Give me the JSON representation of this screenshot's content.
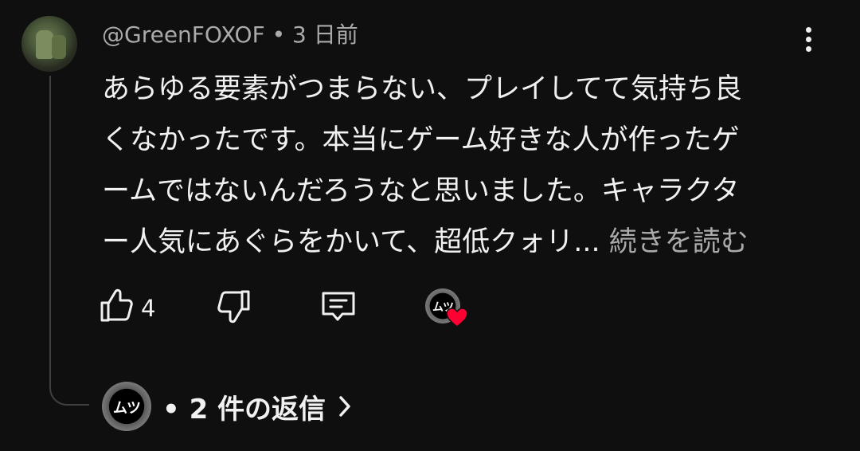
{
  "comment": {
    "author": "@GreenFOXOF",
    "separator": "•",
    "time": "3 日前",
    "lines": [
      "あらゆる要素がつまらない、プレイしてて気持ち良",
      "くなかったです。本当にゲーム好きな人が作ったゲ",
      "ームではないんだろうなと思いました。キャラクタ",
      "ー人気にあぐらをかいて、超低クォリ..."
    ],
    "read_more": "続きを読む"
  },
  "actions": {
    "like_count": "4",
    "creator_avatar_text": "ムツ",
    "heart_color": "#ff0033"
  },
  "replies": {
    "avatar_text": "ムツ",
    "label": "• 2 件の返信"
  },
  "icons": {
    "more": "more-vert-icon",
    "like": "thumb-up-icon",
    "dislike": "thumb-down-icon",
    "reply": "comment-icon",
    "heart": "heart-icon",
    "chevron": "chevron-right-icon"
  }
}
